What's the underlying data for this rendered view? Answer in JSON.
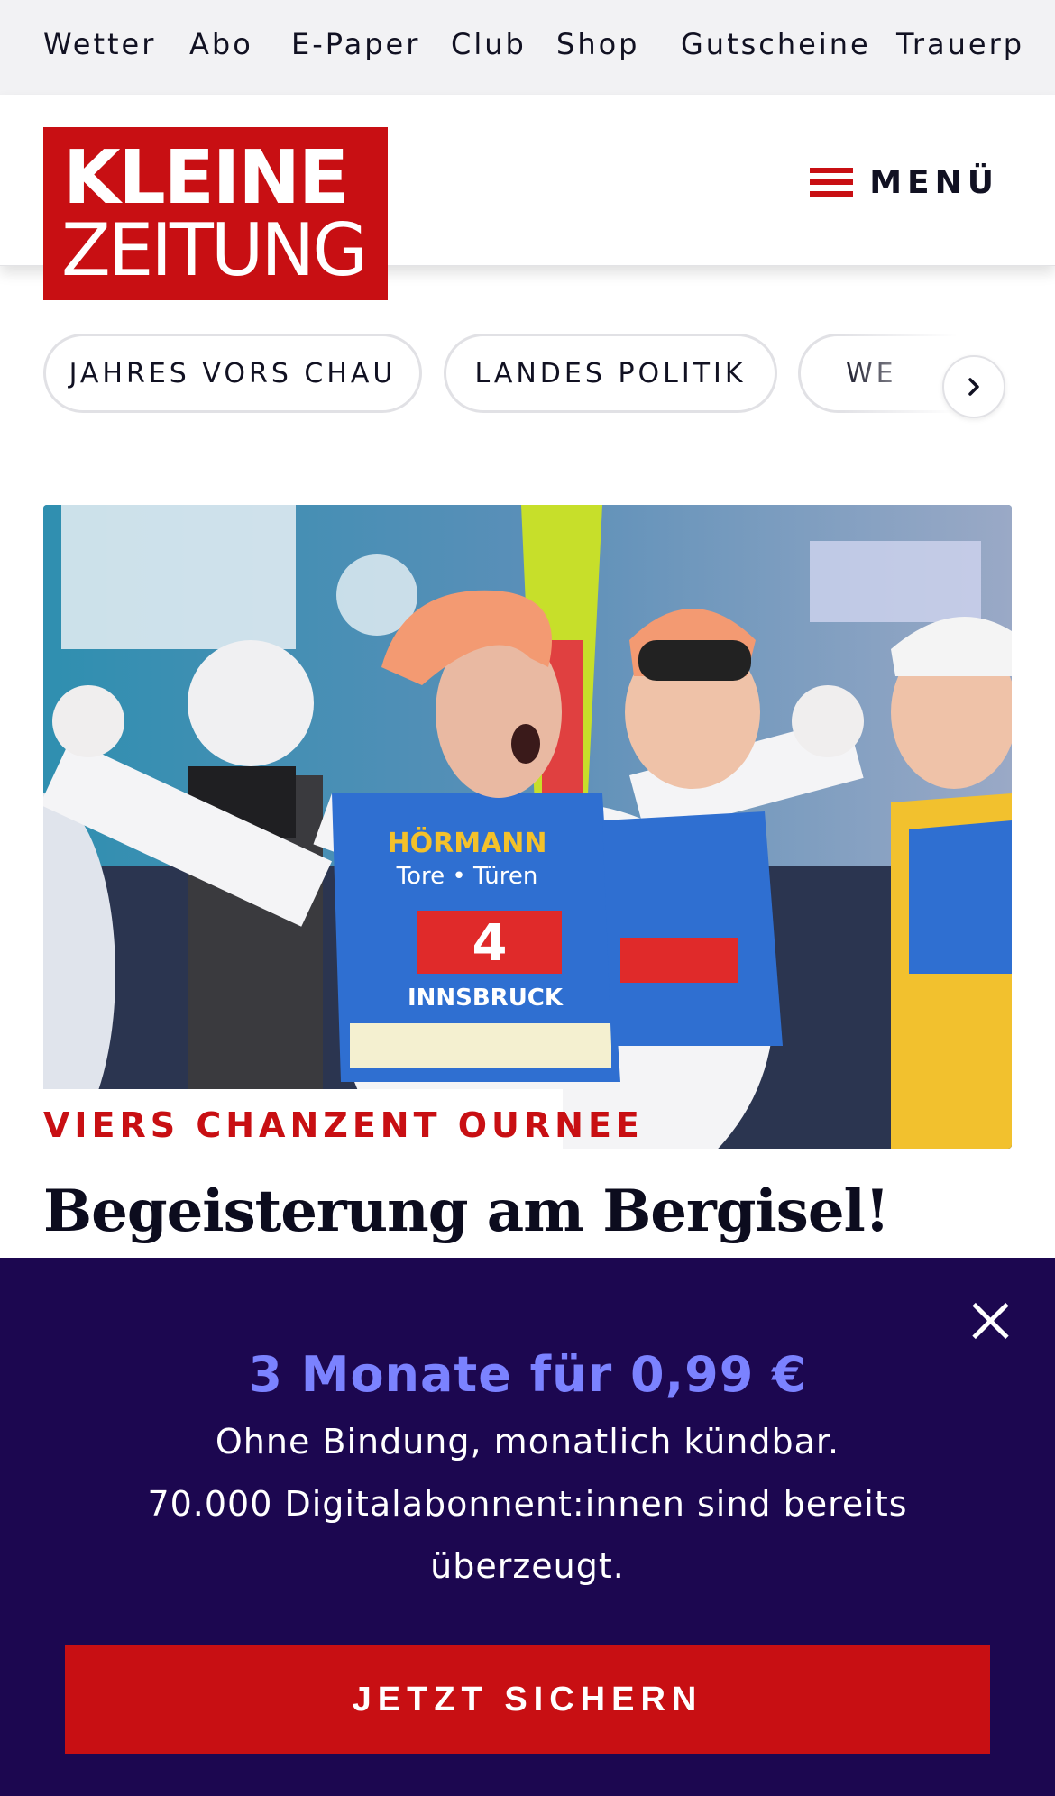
{
  "topbar": {
    "links": [
      "Wetter",
      "Abo",
      "E-Paper",
      "Club",
      "Shop",
      "Gutscheine",
      "Trauerp"
    ]
  },
  "header": {
    "logo_line1": "KLEINE",
    "logo_line2": "ZEITUNG",
    "menu_label": "MENÜ",
    "menu_icon": "hamburger-icon"
  },
  "tags": {
    "items": [
      "JAHRES VORS CHAU",
      "LANDES POLITIK",
      "WE"
    ],
    "next_icon": "chevron-right-icon"
  },
  "article": {
    "kicker": "VIERS CHANZENT OURNEE",
    "headline": "Begeisterung am Bergisel!",
    "image_bib_main": "4",
    "image_sponsor": "HÖRMANN",
    "image_sponsor_sub": "Tore • Türen",
    "image_event": "INNSBRUCK"
  },
  "paywall": {
    "offer": "3 Monate für 0,99 €",
    "line1": "Ohne Bindung, monatlich kündbar.",
    "line2": "70.000 Digitalabonnent:innen sind bereits überzeugt.",
    "cta_label": "JETZT SICHERN",
    "close_icon": "close-icon",
    "colors": {
      "background": "#1c0750",
      "accent": "#7b82ff",
      "brand_red": "#c80f13"
    }
  }
}
